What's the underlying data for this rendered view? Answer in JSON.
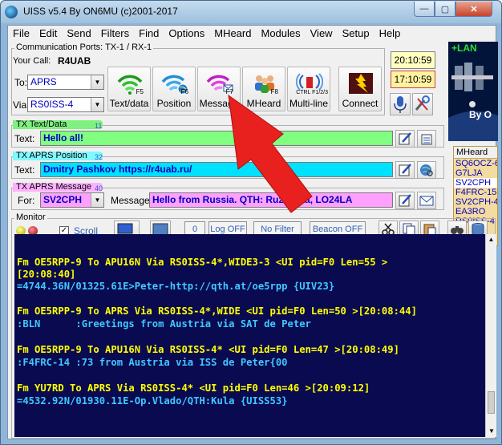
{
  "window": {
    "title": "UISS v5.4 By ON6MU (c)2001-2017",
    "min_glyph": "—",
    "max_glyph": "▢",
    "close_glyph": "✕"
  },
  "menu": [
    "File",
    "Edit",
    "Send",
    "Filters",
    "Find",
    "Options",
    "MHeard",
    "Modules",
    "View",
    "Setup",
    "Help"
  ],
  "ports": {
    "label": "Communication Ports: TX-1 / RX-1"
  },
  "station": {
    "call_label": "Your Call:",
    "call_value": "R4UAB",
    "to_label": "To:",
    "to_value": "APRS",
    "via_label": "Via:",
    "via_value": "RS0ISS-4"
  },
  "toolbar": [
    {
      "key": "F5",
      "label": "Text/data"
    },
    {
      "key": "F6",
      "label": "Position"
    },
    {
      "key": "F7",
      "label": "Message"
    },
    {
      "key": "F8",
      "label": "MHeard"
    },
    {
      "key": "CTRL F1/2/3",
      "label": "Multi-line"
    },
    {
      "key": "",
      "label": "Connect"
    }
  ],
  "clocks": {
    "local": "20:10:59",
    "utc": "17:10:59"
  },
  "sat_panel": {
    "lan": "+LAN",
    "caption": "By O"
  },
  "tx_text": {
    "title": "TX Text/Data",
    "count": "11",
    "field_label": "Text:",
    "value": "Hello all!"
  },
  "tx_position": {
    "title": "TX APRS Position",
    "count": "32",
    "field_label": "Text:",
    "value": "Dmitry Pashkov https://r4uab.ru/"
  },
  "tx_message": {
    "title": "TX APRS Message",
    "count": "40",
    "for_label": "For:",
    "for_value": "SV2CPH",
    "message_label": "Message:",
    "message_value": "Hello from Russia. QTH: Ruzaevka, LO24LA"
  },
  "mheard": {
    "title": "MHeard",
    "items": [
      "SQ6OCZ-6",
      "G7LJA",
      "SV2CPH",
      "F4FRC-15",
      "SV2CPH-4",
      "EA3RO",
      "RS0ISS-4"
    ],
    "selected_index": 2
  },
  "monitor": {
    "title": "Monitor",
    "scroll_label": "Scroll",
    "scroll_checked": true,
    "counter": "0",
    "log_label": "Log OFF",
    "filter_label": "No Filter",
    "beacon_label": "Beacon OFF"
  },
  "colors": {
    "console_bg": "#0a0a50",
    "header_text": "#ffff00",
    "body_text": "#40c8ff",
    "text_highlight": "#80ff80",
    "position_highlight": "#00e0ff",
    "message_highlight": "#ffa0ff"
  },
  "console_lines": [
    {
      "text": "Fm OE5RPP-9 To APU16N Via RS0ISS-4*,WIDE3-3 <UI pid=F0 Len=55 >",
      "kind": "header"
    },
    {
      "text": "[20:08:40]",
      "kind": "header"
    },
    {
      "text": "=4744.36N/01325.61E>Peter-http://qth.at/oe5rpp {UIV23}",
      "kind": "body"
    },
    {
      "text": "",
      "kind": "blank"
    },
    {
      "text": "Fm OE5RPP-9 To APRS Via RS0ISS-4*,WIDE <UI pid=F0 Len=50 >[20:08:44]",
      "kind": "header"
    },
    {
      "text": ":BLN      :Greetings from Austria via SAT de Peter",
      "kind": "body"
    },
    {
      "text": "",
      "kind": "blank"
    },
    {
      "text": "Fm OE5RPP-9 To APU16N Via RS0ISS-4* <UI pid=F0 Len=47 >[20:08:49]",
      "kind": "header"
    },
    {
      "text": ":F4FRC-14 :73 from Austria via ISS de Peter{00",
      "kind": "body"
    },
    {
      "text": "",
      "kind": "blank"
    },
    {
      "text": "Fm YU7RD To APRS Via RS0ISS-4* <UI pid=F0 Len=46 >[20:09:12]",
      "kind": "header"
    },
    {
      "text": "=4532.92N/01930.11E-Op.Vlado/QTH:Kula {UISS53}",
      "kind": "body"
    }
  ]
}
